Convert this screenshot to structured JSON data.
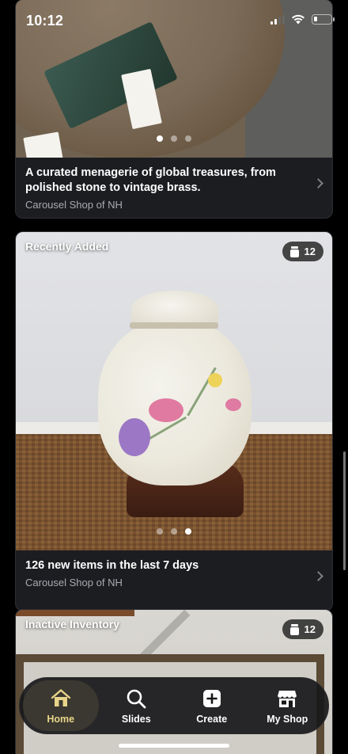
{
  "status_bar": {
    "time": "10:12"
  },
  "cards": [
    {
      "title": "A curated menagerie of global treasures, from polished stone to vintage brass.",
      "subtitle": "Carousel Shop of NH",
      "dots": 3,
      "active_dot": 0
    },
    {
      "label": "Recently Added",
      "count": "12",
      "title": "126 new items in the last 7 days",
      "subtitle": "Carousel Shop of NH",
      "dots": 3,
      "active_dot": 2
    },
    {
      "label": "Inactive Inventory",
      "count": "12"
    }
  ],
  "tab_bar": {
    "tabs": [
      {
        "label": "Home",
        "icon": "home-icon",
        "active": true
      },
      {
        "label": "Slides",
        "icon": "search-icon",
        "active": false
      },
      {
        "label": "Create",
        "icon": "plus-square-icon",
        "active": false
      },
      {
        "label": "My Shop",
        "icon": "storefront-icon",
        "active": false
      }
    ]
  },
  "colors": {
    "active_tab": "#e9d58a",
    "background": "#000000",
    "card": "#1b1d21"
  }
}
